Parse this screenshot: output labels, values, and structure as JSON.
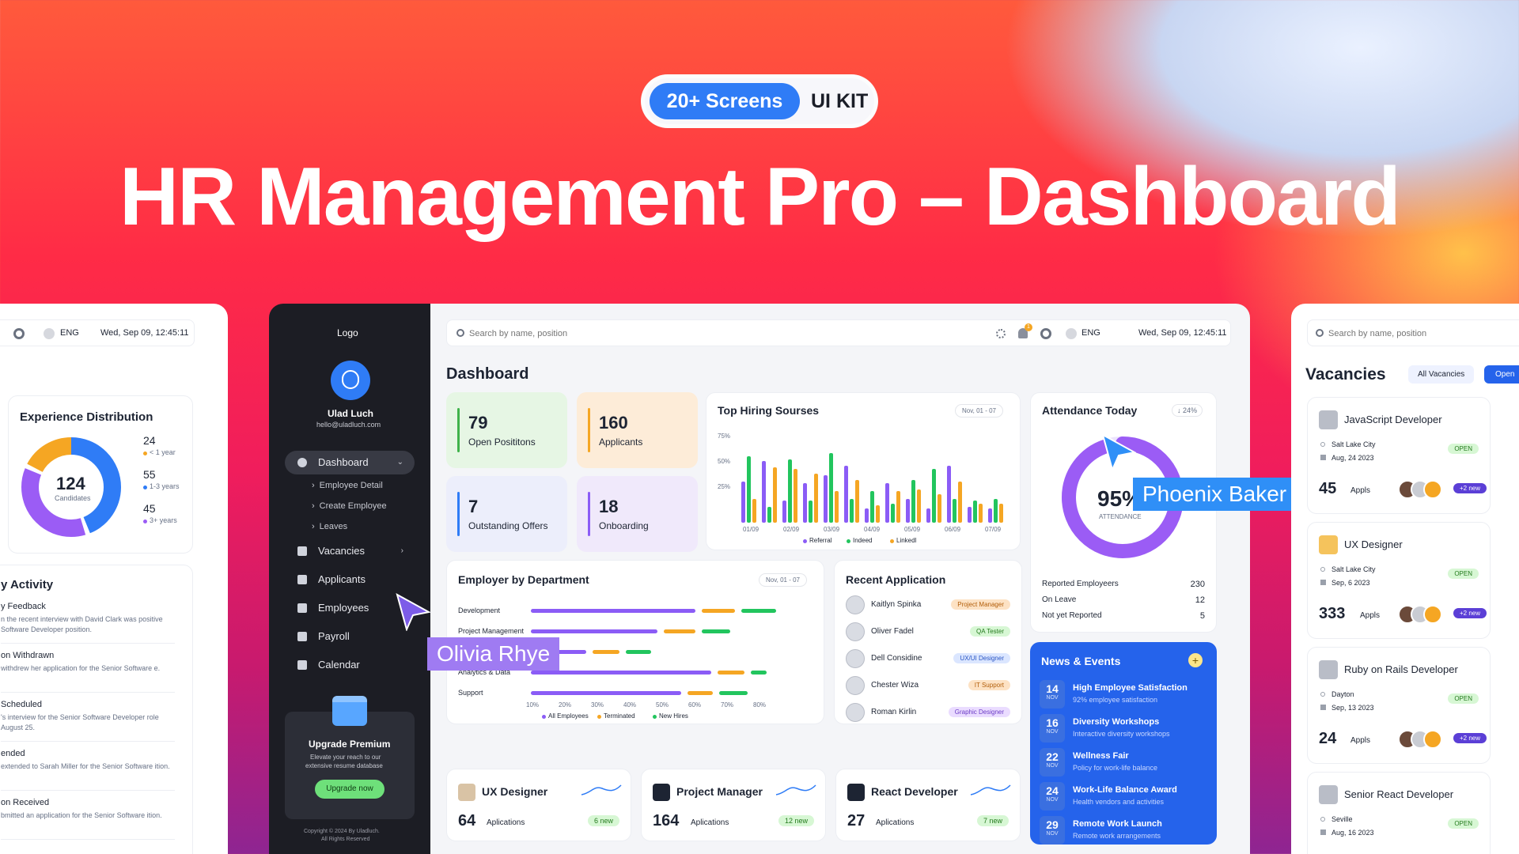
{
  "hero": {
    "screens_label": "20+ Screens",
    "kit_label": "UI KIT",
    "title": "HR Management Pro –  Dashboard"
  },
  "left_panel": {
    "lang": "ENG",
    "datetime": "Wed, Sep 09, 12:45:11",
    "experience": {
      "title": "Experience Distribution",
      "total": "124",
      "total_label": "Candidates",
      "items": [
        {
          "value": "24",
          "label": "< 1 year",
          "color": "#f5a623"
        },
        {
          "value": "55",
          "label": "1-3 years",
          "color": "#2f7cf6"
        },
        {
          "value": "45",
          "label": "3+ years",
          "color": "#9b5cf5"
        }
      ]
    },
    "activity": {
      "title": "y Activity",
      "items": [
        {
          "title": "y Feedback",
          "desc": "n the recent interview with David Clark was positive Software Developer position."
        },
        {
          "title": "on Withdrawn",
          "desc": "withdrew her application for the Senior Software e."
        },
        {
          "title": "Scheduled",
          "desc": "'s interview for the Senior Software Developer role August 25."
        },
        {
          "title": "ended",
          "desc": "extended to Sarah Miller for the Senior Software ition."
        },
        {
          "title": "on Received",
          "desc": "bmitted an application for the Senior Software ition."
        }
      ]
    }
  },
  "sidebar": {
    "logo": "Logo",
    "user_name": "Ulad Luch",
    "user_email": "hello@uladluch.com",
    "dashboard": "Dashboard",
    "sub_items": [
      "Employee Detail",
      "Create Employee",
      "Leaves"
    ],
    "items": [
      "Vacancies",
      "Applicants",
      "Employees",
      "Payroll",
      "Calendar"
    ],
    "upgrade": {
      "title": "Upgrade Premium",
      "desc1": "Elevate your reach to our",
      "desc2": "extensive resume database",
      "button": "Upgrade now"
    },
    "copyright1": "Copyright © 2024 By Uladluch.",
    "copyright2": "All Rights Reserved"
  },
  "topbar": {
    "search_placeholder": "Search by name, position",
    "notif_count": "1",
    "lang": "ENG",
    "datetime": "Wed, Sep 09, 12:45:11"
  },
  "dashboard": {
    "title": "Dashboard",
    "stats": [
      {
        "value": "79",
        "label": "Open Posititons"
      },
      {
        "value": "160",
        "label": "Applicants"
      },
      {
        "value": "7",
        "label": "Outstanding Offers"
      },
      {
        "value": "18",
        "label": "Onboarding"
      }
    ],
    "hiring": {
      "title": "Top Hiring Sourses",
      "range": "Nov, 01 - 07",
      "y_ticks": [
        "75%",
        "50%",
        "25%"
      ],
      "x_ticks": [
        "01/09",
        "02/09",
        "03/09",
        "04/09",
        "05/09",
        "06/09",
        "07/09"
      ],
      "legend": [
        "Referral",
        "Indeed",
        "Linkedl"
      ],
      "colors": [
        "#8b5cf6",
        "#22c55e",
        "#f5a623"
      ]
    },
    "attendance": {
      "title": "Attendance Today",
      "change": "↓ 24%",
      "percent": "95%",
      "percent_label": "ATTENDANCE",
      "value_fraction": 0.95,
      "rows": [
        {
          "label": "Reported Employeers",
          "value": "230"
        },
        {
          "label": "On Leave",
          "value": "12"
        },
        {
          "label": "Not yet Reported",
          "value": "5"
        }
      ]
    },
    "department": {
      "title": "Employer by Department",
      "range": "Nov, 01 - 07",
      "categories": [
        "Development",
        "Project Management",
        "",
        "Analytics & Data",
        "Support"
      ],
      "x_ticks": [
        "10%",
        "20%",
        "30%",
        "40%",
        "50%",
        "60%",
        "70%",
        "80%"
      ],
      "legend": [
        "All Employees",
        "Terminated",
        "New Hires"
      ]
    },
    "recent": {
      "title": "Recent Application",
      "items": [
        {
          "name": "Kaitlyn Spinka",
          "role": "Project Manager",
          "bg": "#fde2c4",
          "fg": "#b25e0a"
        },
        {
          "name": "Oliver Fadel",
          "role": "QA Tester",
          "bg": "#d7f7d4",
          "fg": "#237a1c"
        },
        {
          "name": "Dell Considine",
          "role": "UX/UI Designer",
          "bg": "#dbe6ff",
          "fg": "#2a56c4"
        },
        {
          "name": "Chester Wiza",
          "role": "IT Support",
          "bg": "#fde2c4",
          "fg": "#b25e0a"
        },
        {
          "name": "Roman Kirlin",
          "role": "Graphic Designer",
          "bg": "#eadcff",
          "fg": "#6b3bc6"
        }
      ]
    },
    "news": {
      "title": "News & Events",
      "items": [
        {
          "day": "14",
          "month": "NOV",
          "title": "High Employee Satisfaction",
          "desc": "92% employee satisfaction"
        },
        {
          "day": "16",
          "month": "NOV",
          "title": "Diversity Workshops",
          "desc": "Interactive diversity workshops"
        },
        {
          "day": "22",
          "month": "NOV",
          "title": "Wellness Fair",
          "desc": "Policy for work-life balance"
        },
        {
          "day": "24",
          "month": "NOV",
          "title": "Work-Life Balance Award",
          "desc": "Health vendors and activities"
        },
        {
          "day": "29",
          "month": "NOV",
          "title": "Remote Work Launch",
          "desc": "Remote work arrangements"
        }
      ]
    },
    "jobs": [
      {
        "title": "UX Designer",
        "count": "64",
        "label": "Aplications",
        "new": "6 new"
      },
      {
        "title": "Project Manager",
        "count": "164",
        "label": "Aplications",
        "new": "12 new"
      },
      {
        "title": "React Developer",
        "count": "27",
        "label": "Aplications",
        "new": "7 new"
      }
    ]
  },
  "cursors": {
    "olivia": "Olivia Rhye",
    "phoenix": "Phoenix Baker"
  },
  "right_panel": {
    "search_placeholder": "Search by name, position",
    "title": "Vacancies",
    "all_btn": "All Vacancies",
    "open_btn": "Open",
    "cards": [
      {
        "title": "JavaScript Developer",
        "city": "Salt Lake City",
        "date": "Aug, 24 2023",
        "status": "OPEN",
        "count": "45",
        "label": "Appls",
        "new": "+2 new"
      },
      {
        "title": "UX Designer",
        "city": "Salt Lake City",
        "date": "Sep, 6 2023",
        "status": "OPEN",
        "count": "333",
        "label": "Appls",
        "new": "+2 new"
      },
      {
        "title": "Ruby on Rails Developer",
        "city": "Dayton",
        "date": "Sep, 13 2023",
        "status": "OPEN",
        "count": "24",
        "label": "Appls",
        "new": "+2 new"
      },
      {
        "title": "Senior React Developer",
        "city": "Seville",
        "date": "Aug, 16 2023",
        "status": "OPEN",
        "count": "",
        "label": "",
        "new": ""
      }
    ]
  }
}
